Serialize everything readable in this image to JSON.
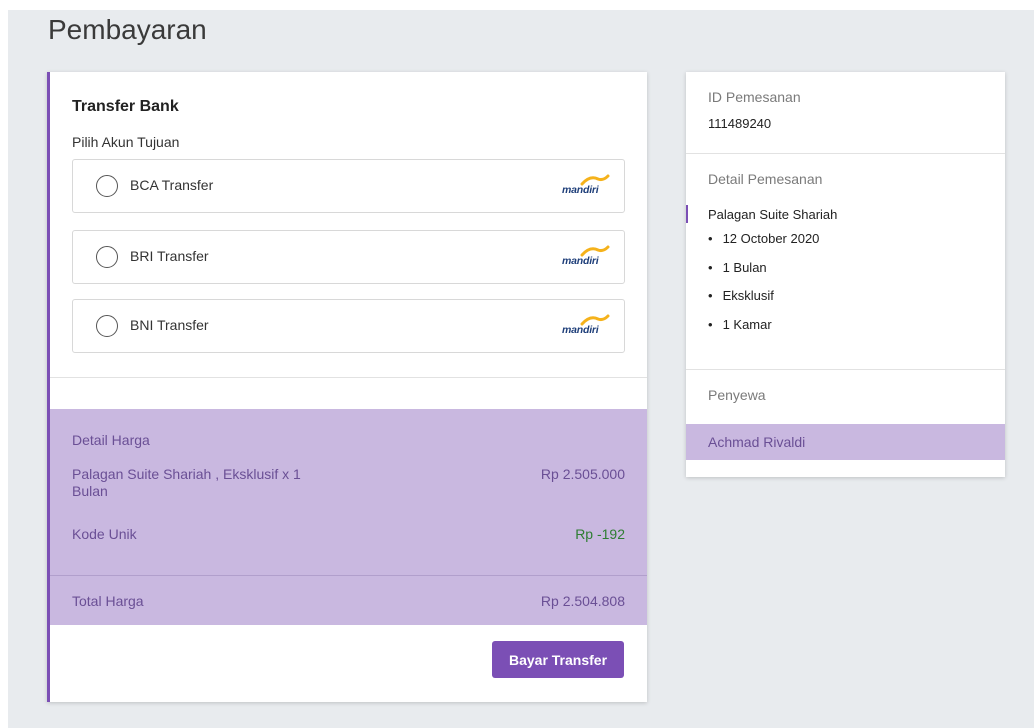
{
  "page": {
    "title": "Pembayaran"
  },
  "payment": {
    "title": "Transfer Bank",
    "subtitle": "Pilih Akun Tujuan",
    "options": [
      {
        "label": "BCA Transfer",
        "logo_text": "mandiri",
        "logo_icon": "mandiri-logo-icon"
      },
      {
        "label": "BRI Transfer",
        "logo_text": "mandiri",
        "logo_icon": "mandiri-logo-icon"
      },
      {
        "label": "BNI Transfer",
        "logo_text": "mandiri",
        "logo_icon": "mandiri-logo-icon"
      }
    ],
    "price": {
      "heading": "Detail Harga",
      "item_label": "Palagan Suite Shariah , Eksklusif x 1 Bulan",
      "item_value": "Rp 2.505.000",
      "kode_label": "Kode Unik",
      "kode_value": "Rp -192",
      "total_label": "Total Harga",
      "total_value": "Rp 2.504.808"
    },
    "button_label": "Bayar Transfer"
  },
  "order": {
    "id_label": "ID Pemesanan",
    "id_value": "111489240",
    "detail_label": "Detail Pemesanan",
    "property_name": "Palagan Suite Shariah",
    "details": [
      "12 October 2020",
      "1 Bulan",
      "Eksklusif",
      "1 Kamar"
    ],
    "tenant_label": "Penyewa",
    "tenant_name": "Achmad Rivaldi"
  },
  "colors": {
    "accent": "#7b4fb5",
    "price_bg": "#c9b8e0",
    "price_text": "#6a4f95",
    "discount_text": "#2e7d32",
    "page_bg": "#e8ebee"
  }
}
